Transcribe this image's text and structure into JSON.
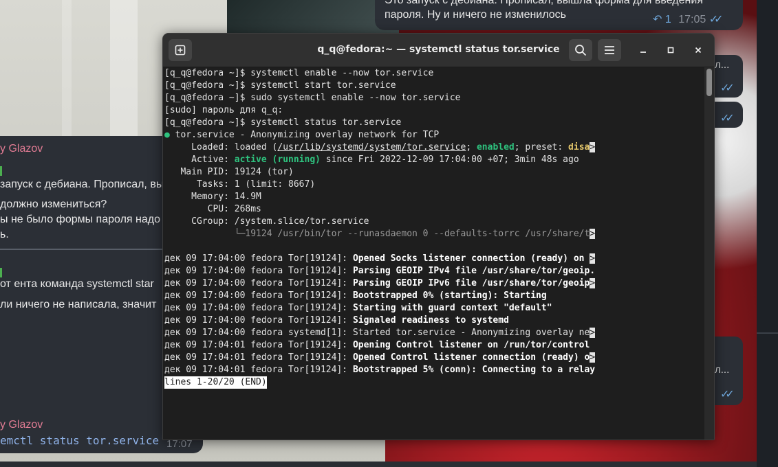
{
  "terminal": {
    "title": "q_q@fedora:~ — systemctl status tor.service",
    "lines": [
      {
        "parts": [
          {
            "t": "[q_q@fedora ~]$ systemctl enable --now tor.service"
          }
        ]
      },
      {
        "parts": [
          {
            "t": "[q_q@fedora ~]$ systemctl start tor.service"
          }
        ]
      },
      {
        "parts": [
          {
            "t": "[q_q@fedora ~]$ sudo systemctl enable --now tor.service"
          }
        ]
      },
      {
        "parts": [
          {
            "t": "[sudo] пароль для q_q:"
          }
        ]
      },
      {
        "parts": [
          {
            "t": "[q_q@fedora ~]$ systemctl status tor.service"
          }
        ]
      },
      {
        "parts": [
          {
            "t": "●",
            "c": "dot"
          },
          {
            "t": " tor.service - Anonymizing overlay network for TCP"
          }
        ]
      },
      {
        "parts": [
          {
            "t": "     Loaded: loaded ("
          },
          {
            "t": "/usr/lib/systemd/system/tor.service",
            "c": "under"
          },
          {
            "t": "; "
          },
          {
            "t": "enabled",
            "c": "green"
          },
          {
            "t": "; preset: "
          },
          {
            "t": "disa",
            "c": "yellow"
          },
          {
            "t": ">",
            "c": "trunc"
          }
        ]
      },
      {
        "parts": [
          {
            "t": "     Active: "
          },
          {
            "t": "active (running)",
            "c": "green"
          },
          {
            "t": " since Fri 2022-12-09 17:04:00 +07; 3min 48s ago"
          }
        ]
      },
      {
        "parts": [
          {
            "t": "   Main PID: 19124 (tor)"
          }
        ]
      },
      {
        "parts": [
          {
            "t": "      Tasks: 1 (limit: 8667)"
          }
        ]
      },
      {
        "parts": [
          {
            "t": "     Memory: 14.9M"
          }
        ]
      },
      {
        "parts": [
          {
            "t": "        CPU: 268ms"
          }
        ]
      },
      {
        "parts": [
          {
            "t": "     CGroup: /system.slice/tor.service"
          }
        ]
      },
      {
        "parts": [
          {
            "t": "             └─",
            "c": "dim"
          },
          {
            "t": "19124 /usr/bin/tor --runasdaemon 0 --defaults-torrc /usr/share/t",
            "c": "dim"
          },
          {
            "t": ">",
            "c": "trunc"
          }
        ]
      },
      {
        "parts": [
          {
            "t": " "
          }
        ]
      },
      {
        "parts": [
          {
            "t": "дек 09 17:04:00 fedora Tor[19124]: "
          },
          {
            "t": "Opened Socks listener connection (ready) on ",
            "c": "b"
          },
          {
            "t": ">",
            "c": "trunc"
          }
        ]
      },
      {
        "parts": [
          {
            "t": "дек 09 17:04:00 fedora Tor[19124]: "
          },
          {
            "t": "Parsing GEOIP IPv4 file /usr/share/tor/geoip.",
            "c": "b"
          }
        ]
      },
      {
        "parts": [
          {
            "t": "дек 09 17:04:00 fedora Tor[19124]: "
          },
          {
            "t": "Parsing GEOIP IPv6 file /usr/share/tor/geoip",
            "c": "b"
          },
          {
            "t": ">",
            "c": "trunc"
          }
        ]
      },
      {
        "parts": [
          {
            "t": "дек 09 17:04:00 fedora Tor[19124]: "
          },
          {
            "t": "Bootstrapped 0% (starting): Starting",
            "c": "b"
          }
        ]
      },
      {
        "parts": [
          {
            "t": "дек 09 17:04:00 fedora Tor[19124]: "
          },
          {
            "t": "Starting with guard context \"default\"",
            "c": "b"
          }
        ]
      },
      {
        "parts": [
          {
            "t": "дек 09 17:04:00 fedora Tor[19124]: "
          },
          {
            "t": "Signaled readiness to systemd",
            "c": "b"
          }
        ]
      },
      {
        "parts": [
          {
            "t": "дек 09 17:04:00 fedora systemd[1]: Started tor.service - Anonymizing overlay ne"
          },
          {
            "t": ">",
            "c": "trunc"
          }
        ]
      },
      {
        "parts": [
          {
            "t": "дек 09 17:04:01 fedora Tor[19124]: "
          },
          {
            "t": "Opening Control listener on /run/tor/control",
            "c": "b"
          }
        ]
      },
      {
        "parts": [
          {
            "t": "дек 09 17:04:01 fedora Tor[19124]: "
          },
          {
            "t": "Opened Control listener connection (ready) o",
            "c": "b"
          },
          {
            "t": ">",
            "c": "trunc"
          }
        ]
      },
      {
        "parts": [
          {
            "t": "дек 09 17:04:01 fedora Tor[19124]: "
          },
          {
            "t": "Bootstrapped 5% (conn): Connecting to a relay",
            "c": "b"
          }
        ]
      }
    ],
    "status_line": "lines 1-20/20 (END)",
    "icons": {
      "new_tab": "new-tab-icon",
      "search": "search-icon",
      "menu": "hamburger-menu-icon",
      "minimize": "minimize-icon",
      "maximize": "maximize-icon",
      "close": "close-icon"
    }
  },
  "chat": {
    "top_right": {
      "line1": "Это запуск с дебиана. Прописал, вышла форма для введения",
      "line2": "пароля. Ну и ничего не изменилось",
      "reply_count": "1",
      "time": "17:05"
    },
    "left": {
      "sender": "y Glazov",
      "lines": [
        "запуск с дебиана. Прописал, вы",
        "должно измениться?",
        "ы не было формы пароля надо",
        "ь.",
        "от ента команда systemctl star",
        "ли ничего не написала, значит"
      ]
    },
    "left_bottom": {
      "sender": "y Glazov",
      "code": "emctl status tor.service",
      "time": "17:07"
    },
    "side_bubbles": [
      "л...",
      "л..."
    ]
  },
  "colors": {
    "sender_name": "#e27c94",
    "check_blue": "#6fa8dc",
    "terminal_bg": "#1e1e1e",
    "titlebar_bg": "#303030",
    "green": "#2ec27e",
    "yellow": "#e5c76b"
  }
}
